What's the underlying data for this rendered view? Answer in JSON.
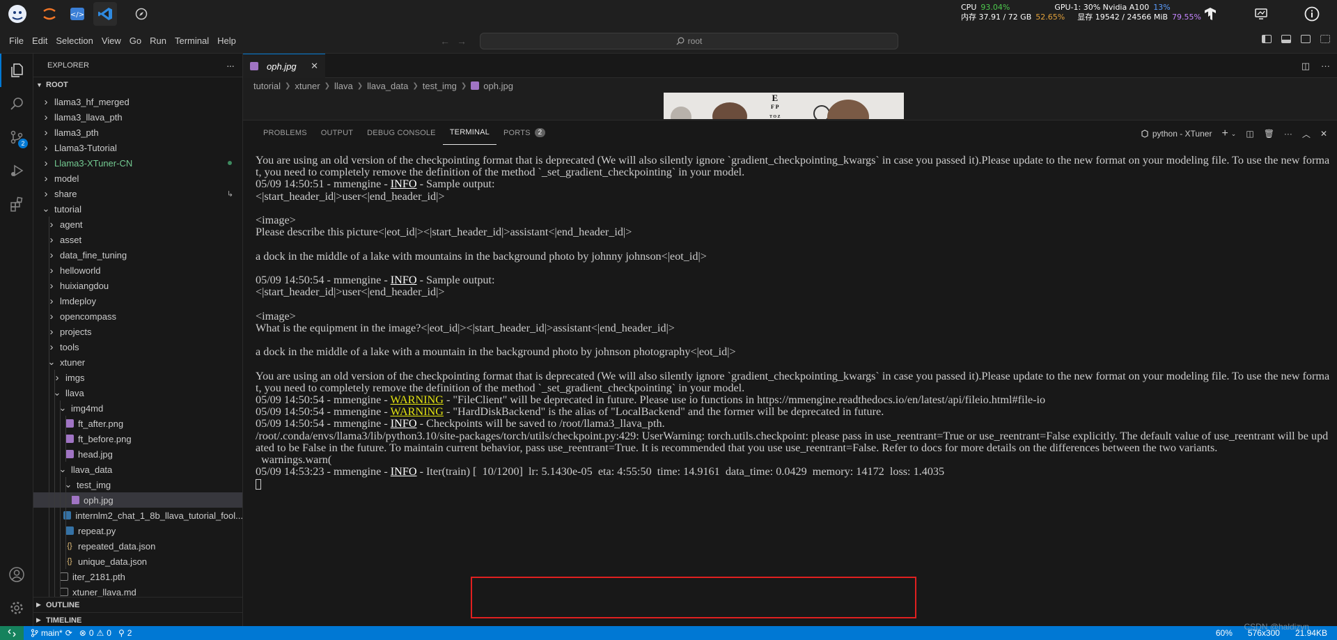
{
  "sysbar": {
    "cpu_label": "CPU",
    "cpu_value": "93.04%",
    "mem_label": "内存 37.91 / 72 GB",
    "mem_value": "52.65%",
    "gpu_label": "GPU-1: 30% Nvidia A100",
    "gpu_value": "13%",
    "vram_label": "显存 19542 / 24566 MiB",
    "vram_value": "79.55%"
  },
  "menu": {
    "items": [
      "File",
      "Edit",
      "Selection",
      "View",
      "Go",
      "Run",
      "Terminal",
      "Help"
    ],
    "search": "root"
  },
  "sidebar": {
    "title": "EXPLORER",
    "more": "···",
    "root": "ROOT",
    "outline": "OUTLINE",
    "timeline": "TIMELINE",
    "items": [
      {
        "label": "llama3_hf_merged",
        "depth": 0,
        "kind": "folder",
        "open": false
      },
      {
        "label": "llama3_llava_pth",
        "depth": 0,
        "kind": "folder",
        "open": false
      },
      {
        "label": "llama3_pth",
        "depth": 0,
        "kind": "folder",
        "open": false
      },
      {
        "label": "Llama3-Tutorial",
        "depth": 0,
        "kind": "folder",
        "open": false
      },
      {
        "label": "Llama3-XTuner-CN",
        "depth": 0,
        "kind": "folder",
        "open": false,
        "git": true
      },
      {
        "label": "model",
        "depth": 0,
        "kind": "folder",
        "open": false
      },
      {
        "label": "share",
        "depth": 0,
        "kind": "folder",
        "open": false,
        "link": true
      },
      {
        "label": "tutorial",
        "depth": 0,
        "kind": "folder",
        "open": true
      },
      {
        "label": "agent",
        "depth": 1,
        "kind": "folder",
        "open": false
      },
      {
        "label": "asset",
        "depth": 1,
        "kind": "folder",
        "open": false
      },
      {
        "label": "data_fine_tuning",
        "depth": 1,
        "kind": "folder",
        "open": false
      },
      {
        "label": "helloworld",
        "depth": 1,
        "kind": "folder",
        "open": false
      },
      {
        "label": "huixiangdou",
        "depth": 1,
        "kind": "folder",
        "open": false
      },
      {
        "label": "lmdeploy",
        "depth": 1,
        "kind": "folder",
        "open": false
      },
      {
        "label": "opencompass",
        "depth": 1,
        "kind": "folder",
        "open": false
      },
      {
        "label": "projects",
        "depth": 1,
        "kind": "folder",
        "open": false
      },
      {
        "label": "tools",
        "depth": 1,
        "kind": "folder",
        "open": false
      },
      {
        "label": "xtuner",
        "depth": 1,
        "kind": "folder",
        "open": true
      },
      {
        "label": "imgs",
        "depth": 2,
        "kind": "folder",
        "open": false
      },
      {
        "label": "llava",
        "depth": 2,
        "kind": "folder",
        "open": true
      },
      {
        "label": "img4md",
        "depth": 3,
        "kind": "folder",
        "open": true
      },
      {
        "label": "ft_after.png",
        "depth": 4,
        "kind": "image"
      },
      {
        "label": "ft_before.png",
        "depth": 4,
        "kind": "image"
      },
      {
        "label": "head.jpg",
        "depth": 4,
        "kind": "image"
      },
      {
        "label": "llava_data",
        "depth": 3,
        "kind": "folder",
        "open": true
      },
      {
        "label": "test_img",
        "depth": 4,
        "kind": "folder",
        "open": true
      },
      {
        "label": "oph.jpg",
        "depth": 5,
        "kind": "image",
        "selected": true
      },
      {
        "label": "internlm2_chat_1_8b_llava_tutorial_fool...",
        "depth": 4,
        "kind": "python"
      },
      {
        "label": "repeat.py",
        "depth": 4,
        "kind": "python"
      },
      {
        "label": "repeated_data.json",
        "depth": 4,
        "kind": "json"
      },
      {
        "label": "unique_data.json",
        "depth": 4,
        "kind": "json"
      },
      {
        "label": "iter_2181.pth",
        "depth": 3,
        "kind": "file"
      },
      {
        "label": "xtuner_llava.md",
        "depth": 3,
        "kind": "file"
      }
    ]
  },
  "editor": {
    "tab_label": "oph.jpg",
    "tab_close": "✕",
    "breadcrumb": [
      "tutorial",
      "xtuner",
      "llava",
      "llava_data",
      "test_img",
      "oph.jpg"
    ]
  },
  "panel": {
    "tabs": [
      "PROBLEMS",
      "OUTPUT",
      "DEBUG CONSOLE",
      "TERMINAL",
      "PORTS"
    ],
    "active_tab": "TERMINAL",
    "ports_count": "2",
    "shell_label": "python - XTuner"
  },
  "terminal": {
    "lines": [
      {
        "parts": [
          {
            "t": "You are using an old version of the checkpointing format that is deprecated (We will also silently ignore `gradient_checkpointing_kwargs` in case you passed it).Please update to the new format on your modeling file. To use the new format, you need to completely remove the definition of the method `_set_gradient_checkpointing` in your model."
          }
        ]
      },
      {
        "parts": [
          {
            "t": "05/09 14:50:51 - mmengine - "
          },
          {
            "t": "INFO",
            "c": "info"
          },
          {
            "t": " - Sample output:"
          }
        ]
      },
      {
        "parts": [
          {
            "t": "<|start_header_id|>user<|end_header_id|>"
          }
        ]
      },
      {
        "parts": [
          {
            "t": ""
          }
        ]
      },
      {
        "parts": [
          {
            "t": "<image>"
          }
        ]
      },
      {
        "parts": [
          {
            "t": "Please describe this picture<|eot_id|><|start_header_id|>assistant<|end_header_id|>"
          }
        ]
      },
      {
        "parts": [
          {
            "t": ""
          }
        ]
      },
      {
        "parts": [
          {
            "t": "a dock in the middle of a lake with mountains in the background photo by johnny johnson<|eot_id|>"
          }
        ]
      },
      {
        "parts": [
          {
            "t": ""
          }
        ]
      },
      {
        "parts": [
          {
            "t": "05/09 14:50:54 - mmengine - "
          },
          {
            "t": "INFO",
            "c": "info"
          },
          {
            "t": " - Sample output:"
          }
        ]
      },
      {
        "parts": [
          {
            "t": "<|start_header_id|>user<|end_header_id|>"
          }
        ]
      },
      {
        "parts": [
          {
            "t": ""
          }
        ]
      },
      {
        "parts": [
          {
            "t": "<image>"
          }
        ]
      },
      {
        "parts": [
          {
            "t": "What is the equipment in the image?<|eot_id|><|start_header_id|>assistant<|end_header_id|>"
          }
        ]
      },
      {
        "parts": [
          {
            "t": ""
          }
        ]
      },
      {
        "parts": [
          {
            "t": "a dock in the middle of a lake with a mountain in the background photo by johnson photography<|eot_id|>"
          }
        ]
      },
      {
        "parts": [
          {
            "t": ""
          }
        ]
      },
      {
        "parts": [
          {
            "t": "You are using an old version of the checkpointing format that is deprecated (We will also silently ignore `gradient_checkpointing_kwargs` in case you passed it).Please update to the new format on your modeling file. To use the new format, you need to completely remove the definition of the method `_set_gradient_checkpointing` in your model."
          }
        ]
      },
      {
        "parts": [
          {
            "t": "05/09 14:50:54 - mmengine - "
          },
          {
            "t": "WARNING",
            "c": "warn"
          },
          {
            "t": " - \"FileClient\" will be deprecated in future. Please use io functions in https://mmengine.readthedocs.io/en/latest/api/fileio.html#file-io"
          }
        ]
      },
      {
        "parts": [
          {
            "t": "05/09 14:50:54 - mmengine - "
          },
          {
            "t": "WARNING",
            "c": "warn"
          },
          {
            "t": " - \"HardDiskBackend\" is the alias of \"LocalBackend\" and the former will be deprecated in future."
          }
        ]
      },
      {
        "parts": [
          {
            "t": "05/09 14:50:54 - mmengine - "
          },
          {
            "t": "INFO",
            "c": "info"
          },
          {
            "t": " - Checkpoints will be saved to /root/llama3_llava_pth."
          }
        ]
      },
      {
        "parts": [
          {
            "t": "/root/.conda/envs/llama3/lib/python3.10/site-packages/torch/utils/checkpoint.py:429: UserWarning: torch.utils.checkpoint: please pass in use_reentrant=True or use_reentrant=False explicitly. The default value of use_reentrant will be updated to be False in the future. To maintain current behavior, pass use_reentrant=True. It is recommended that you use use_reentrant=False. Refer to docs for more details on the differences between the two variants."
          }
        ]
      },
      {
        "parts": [
          {
            "t": "  warnings.warn("
          }
        ]
      },
      {
        "parts": [
          {
            "t": "05/09 14:53:23 - mmengine - "
          },
          {
            "t": "INFO",
            "c": "info"
          },
          {
            "t": " - Iter(train) [  10/1200]  lr: 5.1430e-05  eta: 4:55:50  time: 14.9161  data_time: 0.0429  memory: 14172  loss: 1.4035"
          }
        ]
      }
    ]
  },
  "statusbar": {
    "branch": "main*",
    "errors": "0",
    "warnings": "0",
    "ports": "2",
    "zoom": "60%",
    "dims": "576x300",
    "size": "21.94KB"
  },
  "watermark": "CSDN @haldizyn"
}
